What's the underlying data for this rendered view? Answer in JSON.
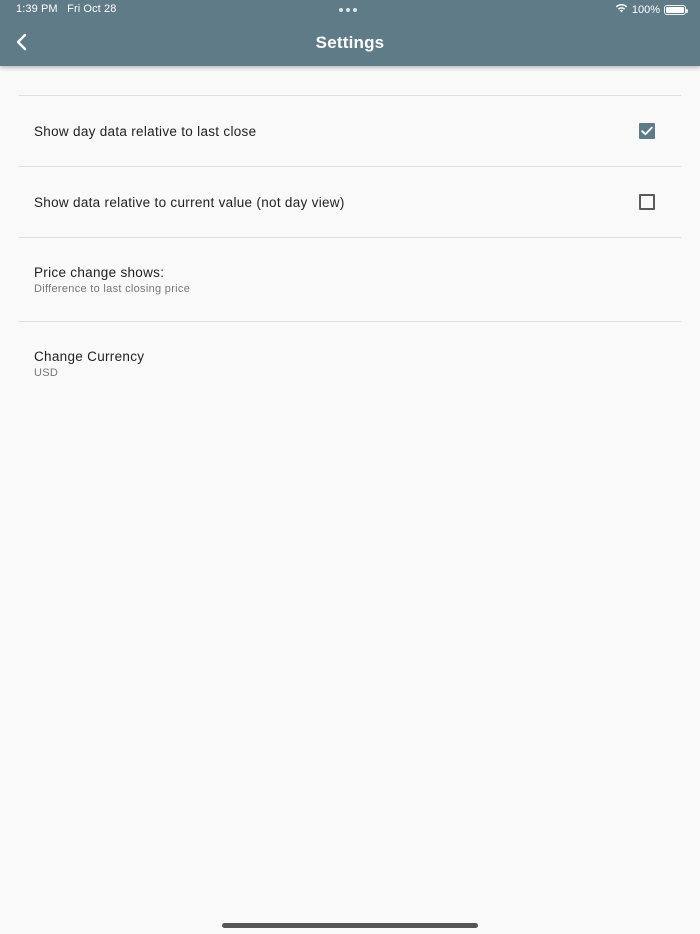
{
  "status_bar": {
    "time": "1:39 PM",
    "date": "Fri Oct 28",
    "battery": "100%",
    "battery_level": 1.0
  },
  "appbar": {
    "title": "Settings",
    "back_icon": "chevron-left-icon",
    "color": "#5f7b87"
  },
  "settings": {
    "relative_to_last_close": {
      "label": "Show day data relative to last close",
      "checked": true
    },
    "relative_to_current_value": {
      "label": "Show data relative to current value (not day view)",
      "checked": false
    },
    "price_change": {
      "label": "Price change shows:",
      "value": "Difference to last closing price"
    },
    "currency": {
      "label": "Change Currency",
      "value": "USD"
    }
  }
}
